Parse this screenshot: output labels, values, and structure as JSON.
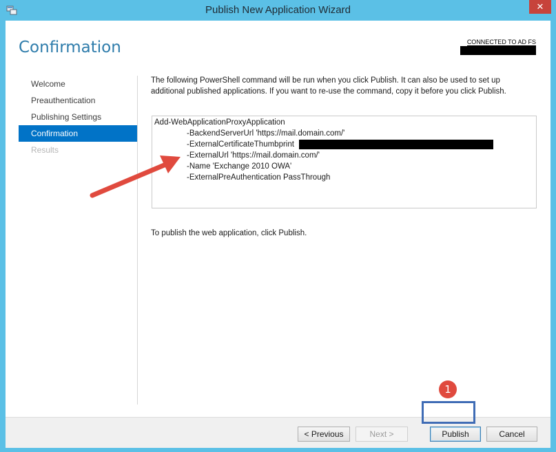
{
  "window": {
    "title": "Publish New Application Wizard",
    "close_glyph": "✕"
  },
  "header": {
    "page_title": "Confirmation",
    "connection_status": "CONNECTED TO AD FS"
  },
  "nav": {
    "items": [
      {
        "label": "Welcome",
        "state": "normal"
      },
      {
        "label": "Preauthentication",
        "state": "normal"
      },
      {
        "label": "Publishing Settings",
        "state": "normal"
      },
      {
        "label": "Confirmation",
        "state": "active"
      },
      {
        "label": "Results",
        "state": "disabled"
      }
    ]
  },
  "main": {
    "description_1": "The following PowerShell command will be run when you click Publish. It can also be used to set up",
    "description_2": "additional published applications. If you want to re-use the command, copy it before you click Publish.",
    "command_lines": [
      "Add-WebApplicationProxyApplication",
      "-BackendServerUrl 'https://mail.domain.com/'",
      "-ExternalCertificateThumbprint",
      "-ExternalUrl 'https://mail.domain.com/'",
      "-Name 'Exchange 2010 OWA'",
      "-ExternalPreAuthentication PassThrough"
    ],
    "publish_note": "To publish the web application, click Publish."
  },
  "footer": {
    "previous_label": "< Previous",
    "next_label": "Next >",
    "publish_label": "Publish",
    "cancel_label": "Cancel"
  },
  "annotation": {
    "step_number": "1",
    "arrow_color": "#e04a3e",
    "highlight_color": "#3f6cb5"
  },
  "colors": {
    "window_border": "#5bc0e6",
    "accent": "#0173c7",
    "title_color": "#2e7cab"
  }
}
